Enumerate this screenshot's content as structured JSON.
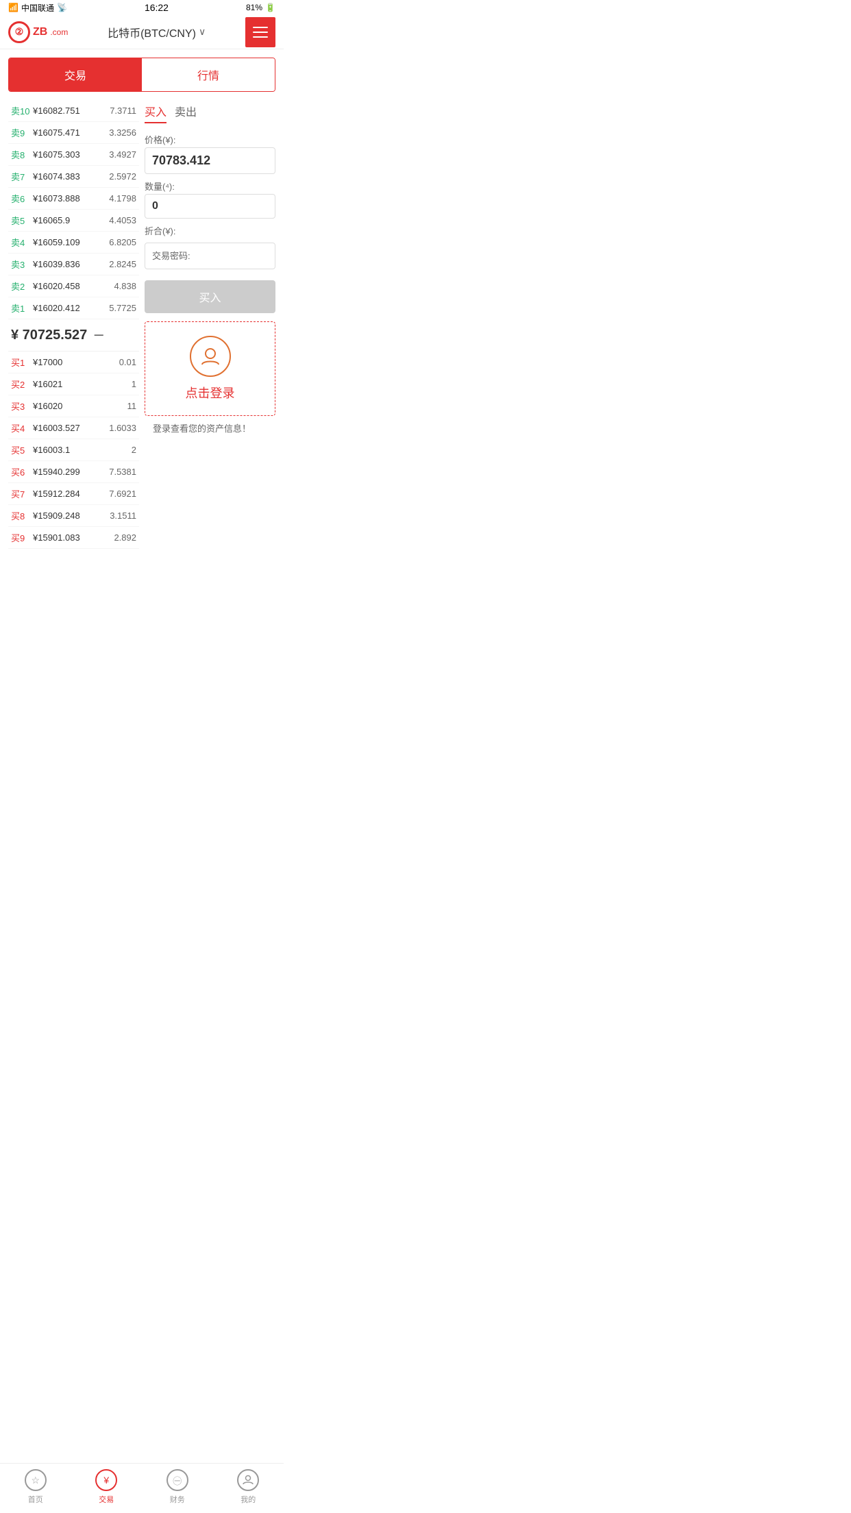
{
  "statusBar": {
    "carrier": "中国联通",
    "time": "16:22",
    "battery": "81%"
  },
  "header": {
    "logoText": "ZB",
    "logoDomain": ".com",
    "title": "比特币(BTC/CNY)",
    "menuAriaLabel": "菜单"
  },
  "tabs": {
    "trade": "交易",
    "market": "行情"
  },
  "sellOrders": [
    {
      "label": "卖10",
      "price": "¥16082.751",
      "qty": "7.3711"
    },
    {
      "label": "卖9",
      "price": "¥16075.471",
      "qty": "3.3256"
    },
    {
      "label": "卖8",
      "price": "¥16075.303",
      "qty": "3.4927"
    },
    {
      "label": "卖7",
      "price": "¥16074.383",
      "qty": "2.5972"
    },
    {
      "label": "卖6",
      "price": "¥16073.888",
      "qty": "4.1798"
    },
    {
      "label": "卖5",
      "price": "¥16065.9",
      "qty": "4.4053"
    },
    {
      "label": "卖4",
      "price": "¥16059.109",
      "qty": "6.8205"
    },
    {
      "label": "卖3",
      "price": "¥16039.836",
      "qty": "2.8245"
    },
    {
      "label": "卖2",
      "price": "¥16020.458",
      "qty": "4.838"
    },
    {
      "label": "卖1",
      "price": "¥16020.412",
      "qty": "5.7725"
    }
  ],
  "currentPrice": "¥ 70725.527",
  "priceIndicator": "－",
  "buyOrders": [
    {
      "label": "买1",
      "price": "¥17000",
      "qty": "0.01"
    },
    {
      "label": "买2",
      "price": "¥16021",
      "qty": "1"
    },
    {
      "label": "买3",
      "price": "¥16020",
      "qty": "11"
    },
    {
      "label": "买4",
      "price": "¥16003.527",
      "qty": "1.6033"
    },
    {
      "label": "买5",
      "price": "¥16003.1",
      "qty": "2"
    },
    {
      "label": "买6",
      "price": "¥15940.299",
      "qty": "7.5381"
    },
    {
      "label": "买7",
      "price": "¥15912.284",
      "qty": "7.6921"
    },
    {
      "label": "买8",
      "price": "¥15909.248",
      "qty": "3.1511"
    },
    {
      "label": "买9",
      "price": "¥15901.083",
      "qty": "2.892"
    }
  ],
  "tradePanel": {
    "buyTab": "买入",
    "sellTab": "卖出",
    "priceLabel": "价格(¥):",
    "priceValue": "70783.412",
    "qtyLabel": "数量(⁴):",
    "qtyValue": "0",
    "totalLabel": "折合(¥):",
    "totalValue": "",
    "passwordLabel": "交易密码:",
    "buyButton": "买入"
  },
  "loginPrompt": {
    "clickLogin": "点击登录",
    "message": "登录查看您的资产信息！"
  },
  "bottomNav": [
    {
      "key": "home",
      "label": "首页",
      "active": false,
      "icon": "★"
    },
    {
      "key": "trade",
      "label": "交易",
      "active": true,
      "icon": "¥"
    },
    {
      "key": "finance",
      "label": "财务",
      "active": false,
      "icon": "💰"
    },
    {
      "key": "mine",
      "label": "我的",
      "active": false,
      "icon": "👤"
    }
  ]
}
